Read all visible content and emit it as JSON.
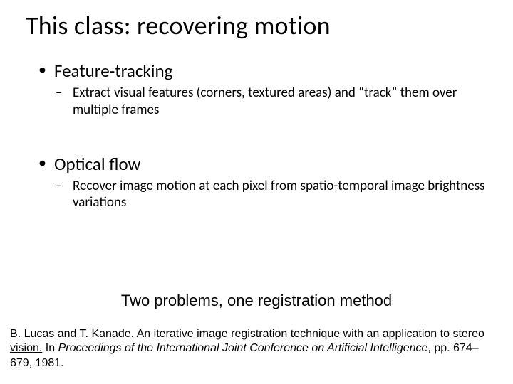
{
  "title": "This class: recovering motion",
  "bullets": {
    "b1": {
      "label": "Feature-tracking",
      "sub": "Extract visual features (corners, textured areas) and “track” them over multiple frames"
    },
    "b2": {
      "label": "Optical flow",
      "sub": "Recover image motion at each pixel from spatio-temporal image brightness variations"
    }
  },
  "subheading": "Two problems, one registration method",
  "citation": {
    "authors": "B. Lucas and T. Kanade. ",
    "title_linked": "An iterative image registration technique with an application to stereo vision.",
    "in_word": " In ",
    "venue": "Proceedings of the International Joint Conference on Artificial Intelligence",
    "tail": ", pp. 674– 679, 1981."
  }
}
